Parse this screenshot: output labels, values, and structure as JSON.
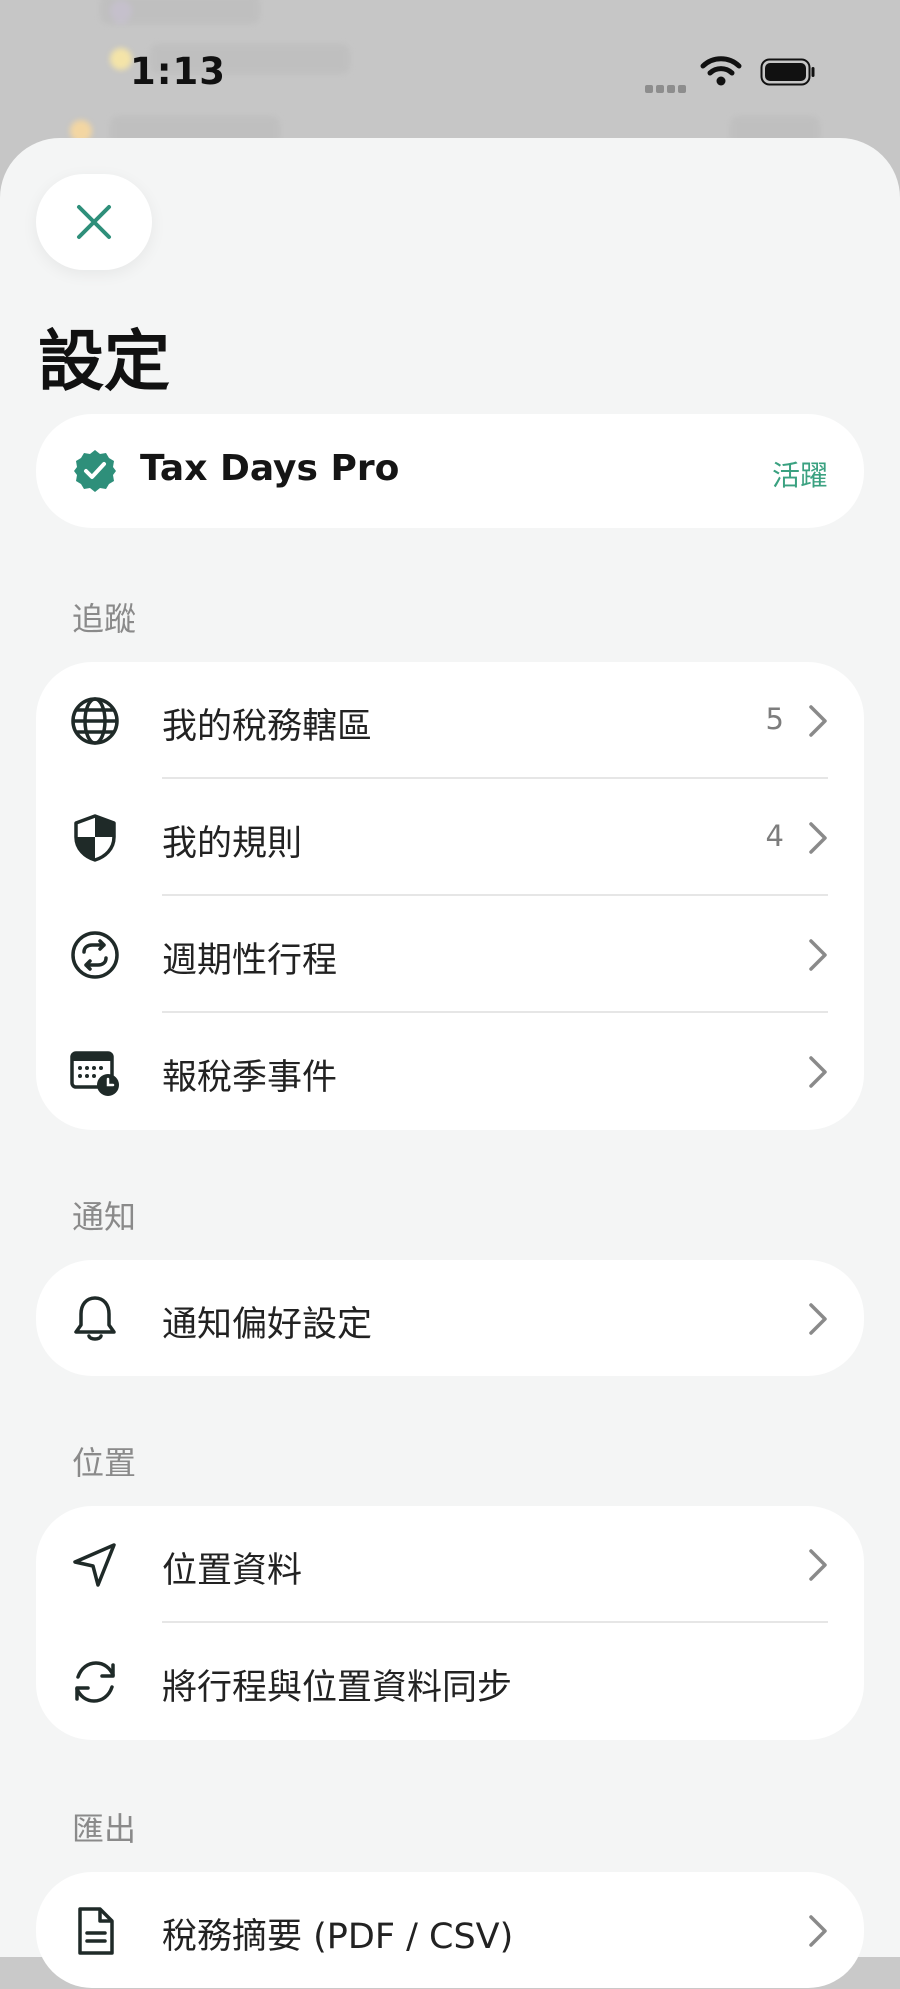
{
  "status_bar": {
    "time": "1:13"
  },
  "header": {
    "title": "設定"
  },
  "pro": {
    "title": "Tax Days Pro",
    "status": "活躍"
  },
  "sections": {
    "tracking": {
      "label": "追蹤",
      "items": [
        {
          "label": "我的稅務轄區",
          "count": "5",
          "icon": "globe-icon"
        },
        {
          "label": "我的規則",
          "count": "4",
          "icon": "shield-icon"
        },
        {
          "label": "週期性行程",
          "icon": "repeat-icon"
        },
        {
          "label": "報稅季事件",
          "icon": "calendar-clock-icon"
        }
      ]
    },
    "notifications": {
      "label": "通知",
      "items": [
        {
          "label": "通知偏好設定",
          "icon": "bell-icon"
        }
      ]
    },
    "location": {
      "label": "位置",
      "items": [
        {
          "label": "位置資料",
          "icon": "location-arrow-icon"
        },
        {
          "label": "將行程與位置資料同步",
          "icon": "sync-icon"
        }
      ]
    },
    "export": {
      "label": "匯出",
      "items": [
        {
          "label": "稅務摘要 (PDF / CSV)",
          "icon": "document-icon"
        }
      ]
    }
  },
  "colors": {
    "accent": "#2e8f7a",
    "status_active": "#3aa180",
    "sheet_bg": "#f4f5f5"
  }
}
